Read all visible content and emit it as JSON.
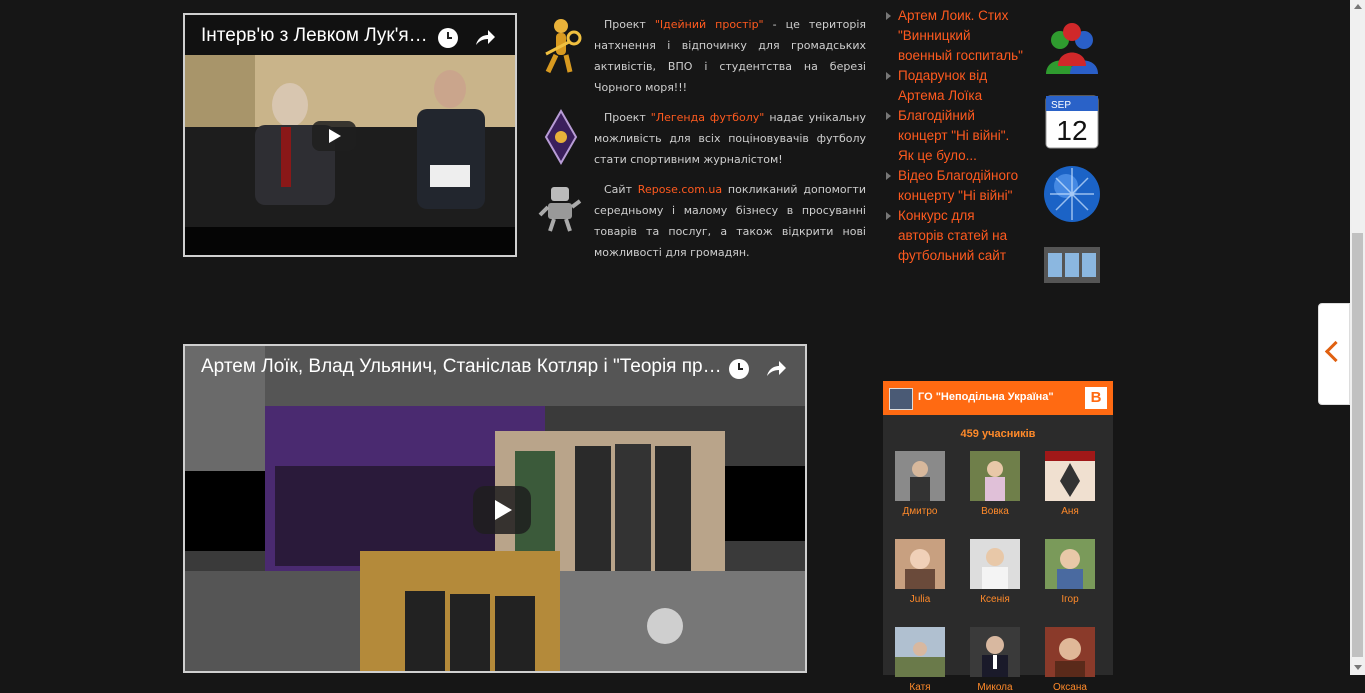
{
  "videos": [
    {
      "title": "Інтерв'ю з Левком Лук'яненком",
      "watch_later_icon": "clock-icon",
      "share_icon": "share-icon"
    },
    {
      "title": "Артем Лоїк, Влад Ульянич, Станіслав Котляр і \"Теорія простору\"",
      "watch_later_icon": "clock-icon",
      "share_icon": "share-icon"
    }
  ],
  "projects": [
    {
      "pre": "Проект ",
      "link": "\"Ідейний простір\"",
      "post": " - це територія натхнення і відпочинку для громадських активістів, ВПО і студентства на березі Чорного моря!!!",
      "icon": "golden-key-figure-icon"
    },
    {
      "pre": "Проект ",
      "link": "\"Легенда футболу\"",
      "post": " надає унікальну можливість для всіх поціновувачів футболу стати спортивним журналістом!",
      "icon": "diamond-logo-icon"
    },
    {
      "pre": "Сайт ",
      "link": "Repose.com.ua",
      "post": " покликаний допомогти середньому і малому бізнесу в просуванні товарів та послуг, а також відкрити нові можливості для громадян.",
      "icon": "robot-figure-icon"
    }
  ],
  "news": [
    "Артем Лоик. Стих \"Винницкий военный госпиталь\"",
    "Подарунок від Артема Лоїка",
    "Благодійний концерт \"Ні війні\". Як це було...",
    "Відео Благодійного концерту \"Ні війні\"",
    "Конкурс для авторів статей на футбольний сайт"
  ],
  "side_icons": [
    {
      "icon": "users-icon"
    },
    {
      "icon": "calendar-icon",
      "month": "SEP",
      "day": "12"
    },
    {
      "icon": "globe-icon"
    },
    {
      "icon": "film-icon"
    }
  ],
  "vk_widget": {
    "group_name": "ГО \"Неподільна Україна\"",
    "vk_letter": "В",
    "members_count": "459 учасників",
    "members": [
      "Дмитро",
      "Вовка",
      "Аня",
      "Julia",
      "Ксенія",
      "Ігор",
      "Катя",
      "Микола",
      "Оксана"
    ]
  },
  "colors": {
    "accent": "#ff5a1f",
    "widget_header": "#ff6a12",
    "background": "#161616"
  }
}
